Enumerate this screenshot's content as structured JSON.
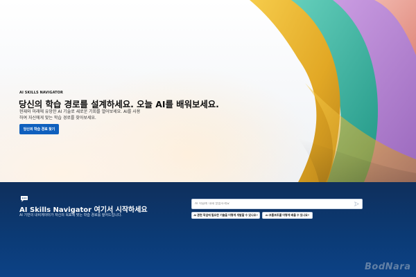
{
  "hero": {
    "eyebrow": "AI SKILLS NAVIGATOR",
    "headline": "당신의 학습 경로를 설계하세요. 오늘 AI를 배워보세요.",
    "description": "현재와 미래에 유망한 AI 기술로 새로운 기회를 열어보세요. AI를 사용하여 자신에게 맞는 학습 경로를 찾아보세요.",
    "cta_label": "당신의 학습 경로 찾기"
  },
  "assistant": {
    "title": "AI Skills Navigator 여기서 시작하세요",
    "subtitle": "AI 기반의 내비게이터가 자신의 목표에 맞는 학습 경로를 짚어드립니다.",
    "input_placeholder": "AI 학습에 대해 말씀하세요",
    "suggestions": [
      "AI 관련 직업에 필요한 기술을 어떻게 개발할 수 있나요?",
      "AI 프롬프트를 어떻게 배울 수 있나요?"
    ]
  },
  "watermark": "BodNara",
  "colors": {
    "navy": "#0b3a74",
    "cta_blue": "#0f5fbd",
    "ribbon_gold": "#e8b52c",
    "ribbon_teal": "#3fb9a6",
    "ribbon_purple": "#b88bd3",
    "ribbon_coral": "#f0a08c"
  },
  "icons": [
    "chat-bubble-icon",
    "send-icon"
  ]
}
